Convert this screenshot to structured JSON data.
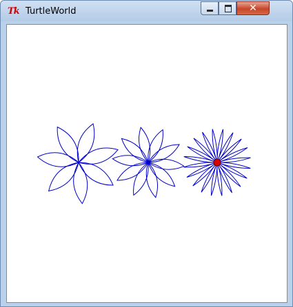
{
  "window": {
    "title": "TurtleWorld",
    "icon": "tk-feather-icon",
    "close_glyph": "✕"
  },
  "canvas": {
    "stroke_color": "#0000cc",
    "turtle_color": "#dd0000",
    "background": "#ffffff",
    "flowers": [
      {
        "petals": 7,
        "petal_length": 60,
        "petal_width": 0.33
      },
      {
        "petals": 10,
        "petal_length": 52,
        "petal_width": 0.28
      },
      {
        "petals": 20,
        "petal_length": 49,
        "petal_width": 0.09
      }
    ]
  }
}
